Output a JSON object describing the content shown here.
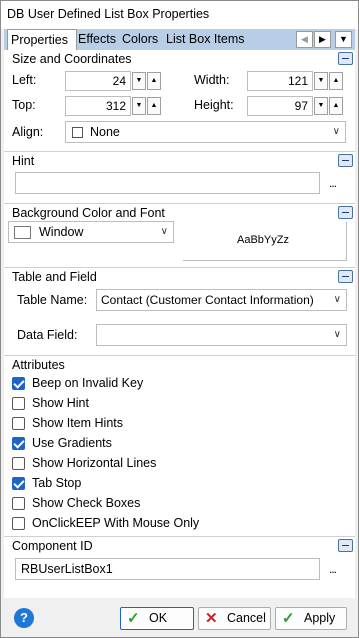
{
  "window": {
    "title": "DB User Defined List Box Properties"
  },
  "tabs": [
    {
      "label": "Properties"
    },
    {
      "label": "Effects"
    },
    {
      "label": "Colors"
    },
    {
      "label": "List Box Items"
    }
  ],
  "size_section": {
    "title": "Size and Coordinates",
    "left_label": "Left:",
    "left_value": "24",
    "top_label": "Top:",
    "top_value": "312",
    "width_label": "Width:",
    "width_value": "121",
    "height_label": "Height:",
    "height_value": "97",
    "align_label": "Align:",
    "align_value": "None"
  },
  "hint_section": {
    "title": "Hint",
    "value": "",
    "browse": "..."
  },
  "bg_section": {
    "title": "Background Color and Font",
    "color_value": "Window",
    "font_preview": "AaBbYyZz"
  },
  "table_section": {
    "title": "Table and Field",
    "table_label": "Table Name:",
    "table_value": "Contact  (Customer Contact Information)",
    "field_label": "Data Field:",
    "field_value": ""
  },
  "attributes": {
    "title": "Attributes",
    "items": [
      {
        "label": "Beep on Invalid Key",
        "checked": true
      },
      {
        "label": "Show Hint",
        "checked": false
      },
      {
        "label": "Show Item Hints",
        "checked": false
      },
      {
        "label": "Use Gradients",
        "checked": true
      },
      {
        "label": "Show Horizontal Lines",
        "checked": false
      },
      {
        "label": "Tab Stop",
        "checked": true
      },
      {
        "label": "Show Check Boxes",
        "checked": false
      },
      {
        "label": "OnClickEEP With Mouse Only",
        "checked": false
      }
    ]
  },
  "component_section": {
    "title": "Component ID",
    "value": "RBUserListBox1",
    "browse": "..."
  },
  "footer": {
    "help": "?",
    "ok": "OK",
    "cancel": "Cancel",
    "apply": "Apply"
  },
  "colors": {
    "accent": "#1e64c8",
    "tabstrip": "#b8cde6"
  }
}
